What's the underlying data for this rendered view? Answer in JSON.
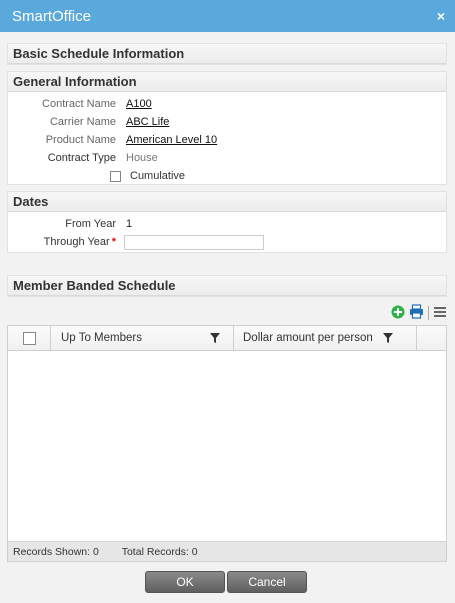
{
  "window": {
    "title": "SmartOffice",
    "close_glyph": "×"
  },
  "sections": {
    "basic": {
      "title": "Basic Schedule Information"
    },
    "general": {
      "title": "General Information",
      "contract_name_label": "Contract Name",
      "contract_name_value": "A100",
      "carrier_name_label": "Carrier Name",
      "carrier_name_value": "ABC Life",
      "product_name_label": "Product Name",
      "product_name_value": "American Level 10",
      "contract_type_label": "Contract Type",
      "contract_type_value": "House",
      "cumulative_label": "Cumulative",
      "cumulative_checked": false
    },
    "dates": {
      "title": "Dates",
      "from_year_label": "From Year",
      "from_year_value": "1",
      "through_year_label": "Through Year",
      "through_year_required": "*",
      "through_year_value": ""
    },
    "member_banded": {
      "title": "Member Banded Schedule",
      "toolbar": {
        "icons": [
          "add-icon",
          "print-icon",
          "menu-icon"
        ]
      },
      "grid": {
        "columns": [
          "Up To Members",
          "Dollar amount per person"
        ],
        "rows": [],
        "footer": {
          "records_shown": "Records Shown: 0",
          "total_records": "Total Records: 0"
        }
      }
    }
  },
  "buttons": {
    "ok": "OK",
    "cancel": "Cancel"
  },
  "colors": {
    "titlebar": "#5aa9dc",
    "button": "#6e6e6e",
    "add_icon": "#2db34a",
    "print_icon": "#1f6fb5"
  }
}
